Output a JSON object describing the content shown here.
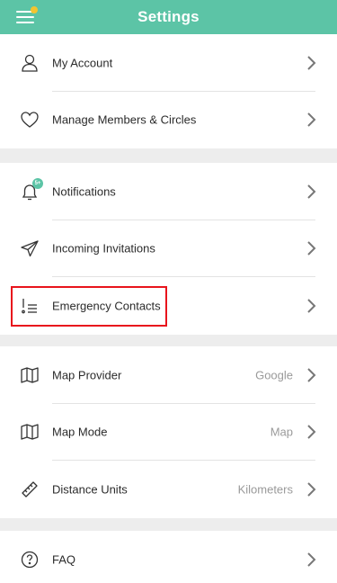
{
  "header": {
    "title": "Settings"
  },
  "section1": [
    {
      "label": "My Account",
      "icon": "person-icon"
    },
    {
      "label": "Manage Members & Circles",
      "icon": "heart-icon"
    }
  ],
  "section2": {
    "notifications": {
      "label": "Notifications",
      "badge": "5+"
    },
    "incoming": {
      "label": "Incoming Invitations"
    },
    "emergency": {
      "label": "Emergency Contacts"
    }
  },
  "section3": {
    "provider": {
      "label": "Map Provider",
      "value": "Google"
    },
    "mode": {
      "label": "Map Mode",
      "value": "Map"
    },
    "units": {
      "label": "Distance Units",
      "value": "Kilometers"
    }
  },
  "section4": {
    "faq": {
      "label": "FAQ"
    }
  },
  "colors": {
    "accent": "#5cc4a6",
    "badge_dot": "#f4c430",
    "highlight": "#e8141c"
  }
}
